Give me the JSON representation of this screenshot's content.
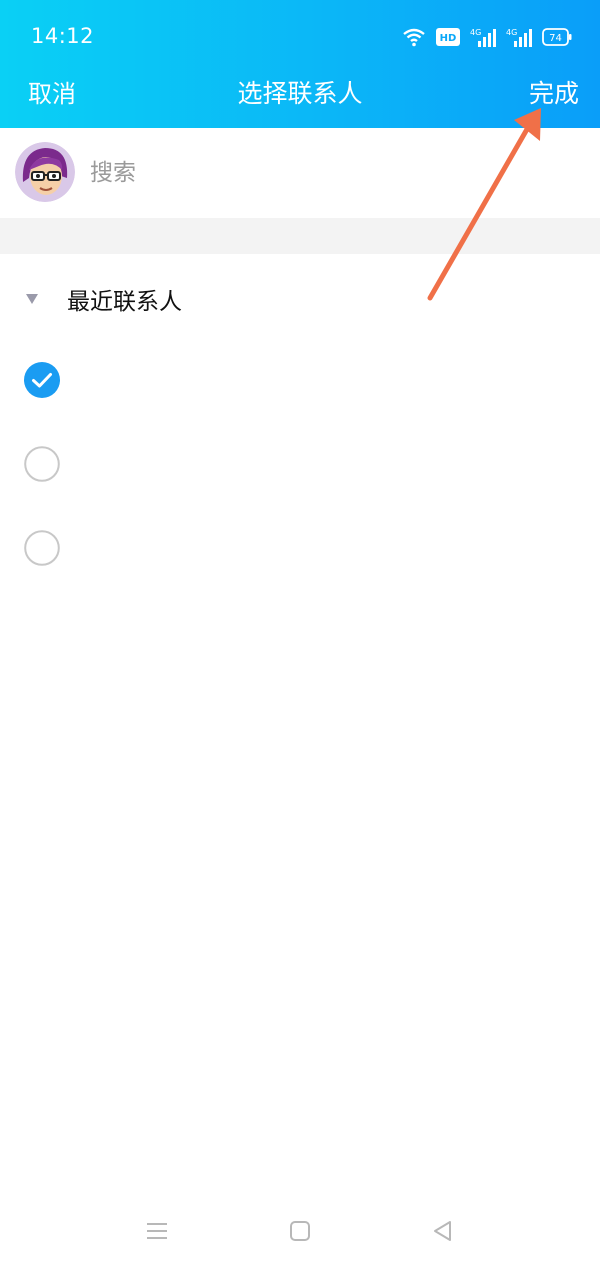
{
  "status_bar": {
    "time": "14:12",
    "battery": "74",
    "icons": [
      "wifi-icon",
      "hd-icon",
      "signal-4g-icon",
      "signal-4g-icon",
      "battery-icon"
    ]
  },
  "nav": {
    "cancel_label": "取消",
    "title": "选择联系人",
    "done_label": "完成"
  },
  "search": {
    "placeholder": "搜索",
    "value": ""
  },
  "group": {
    "label": "最近联系人",
    "expanded": true
  },
  "contacts": [
    {
      "checked": true
    },
    {
      "checked": false
    },
    {
      "checked": false
    }
  ],
  "colors": {
    "header_gradient_start": "#0ad0f5",
    "header_gradient_end": "#0a9ef9",
    "checked_blue": "#1a9cf2",
    "annotation_arrow": "#f07048"
  }
}
